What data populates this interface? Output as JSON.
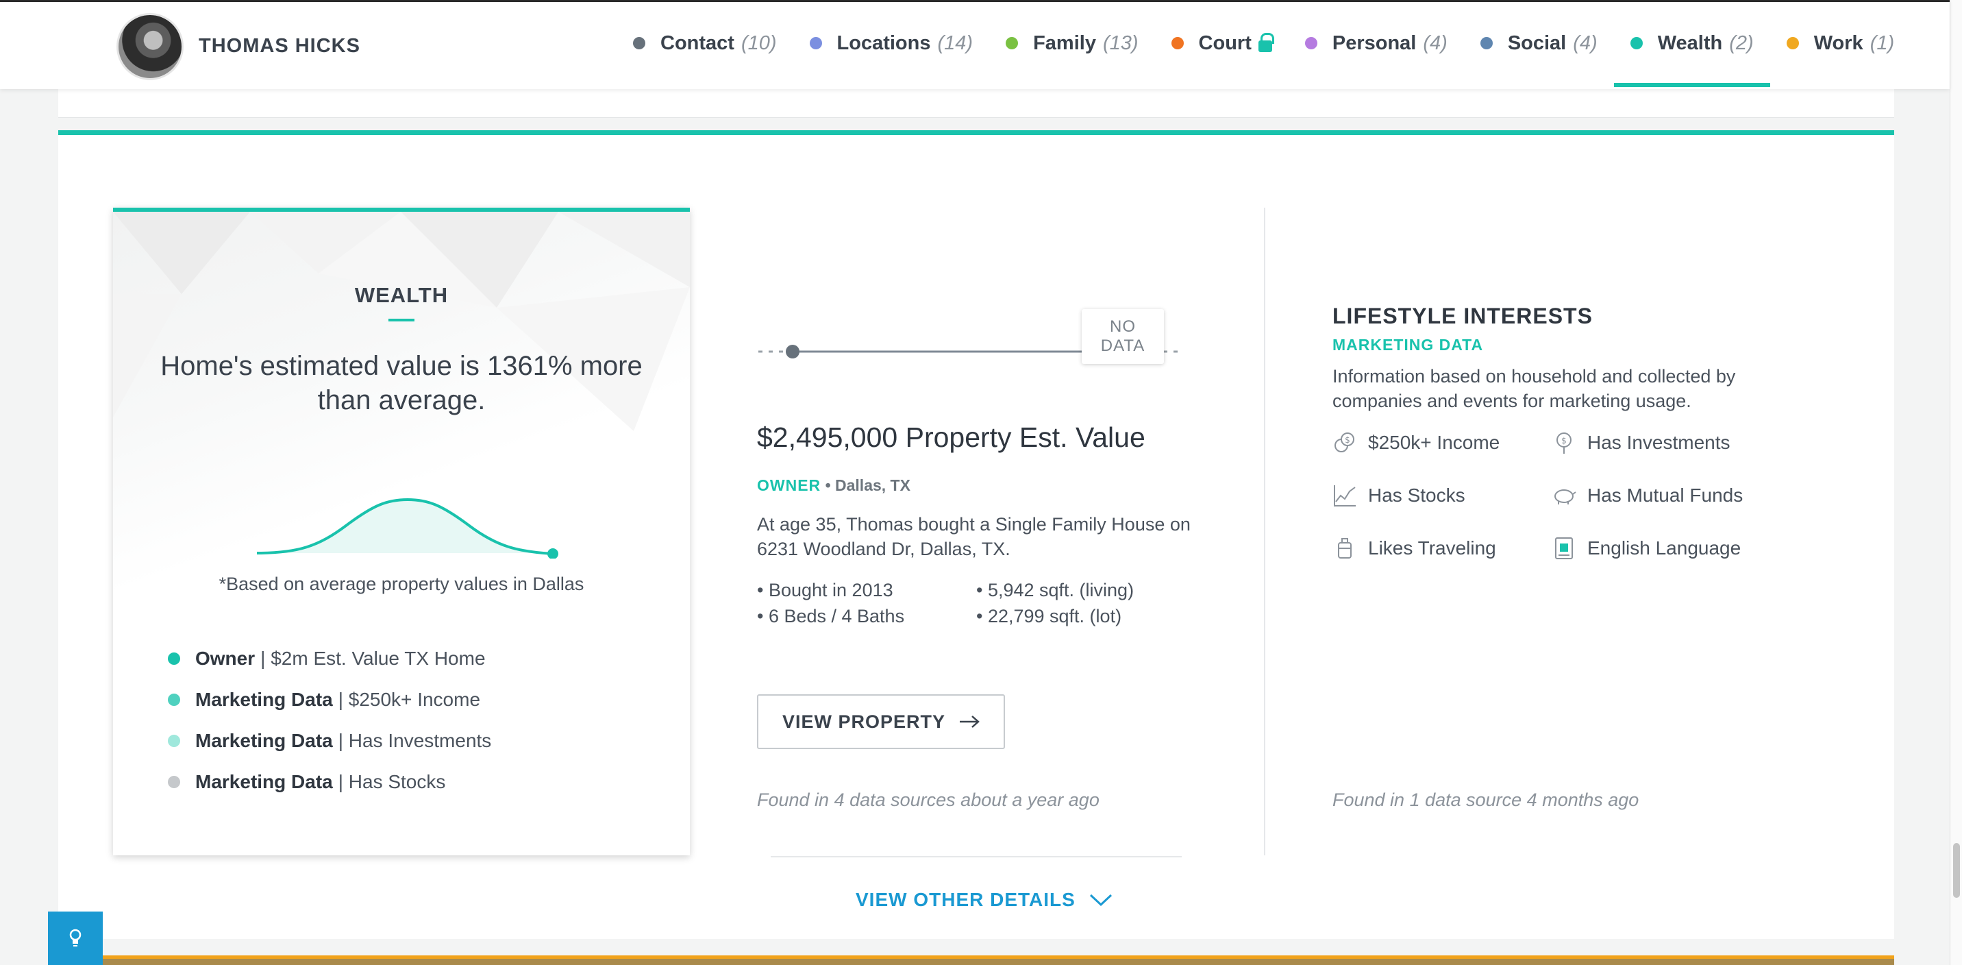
{
  "profile": {
    "name": "THOMAS HICKS"
  },
  "nav": [
    {
      "label": "Contact",
      "count": "(10)",
      "color": "#67717b"
    },
    {
      "label": "Locations",
      "count": "(14)",
      "color": "#7b8fe0"
    },
    {
      "label": "Family",
      "count": "(13)",
      "color": "#7ac142"
    },
    {
      "label": "Court",
      "count": "",
      "color": "#f07422"
    },
    {
      "label": "Personal",
      "count": "(4)",
      "color": "#b57be0"
    },
    {
      "label": "Social",
      "count": "(4)",
      "color": "#5f86b0"
    },
    {
      "label": "Wealth",
      "count": "(2)",
      "color": "#19c2ac"
    },
    {
      "label": "Work",
      "count": "(1)",
      "color": "#f0a820"
    }
  ],
  "wealth": {
    "heading": "WEALTH",
    "statement": "Home's estimated value is 1361% more than average.",
    "note": "*Based on average property values in Dallas",
    "items": [
      {
        "bold": "Owner",
        "text": "| $2m Est. Value TX Home",
        "color": "#19c2ac"
      },
      {
        "bold": "Marketing Data",
        "text": "| $250k+ Income",
        "color": "#4fd1bf"
      },
      {
        "bold": "Marketing Data",
        "text": "| Has Investments",
        "color": "#9fe8dc"
      },
      {
        "bold": "Marketing Data",
        "text": "| Has Stocks",
        "color": "#c5c8cb"
      }
    ]
  },
  "property": {
    "no_data_line1": "NO",
    "no_data_line2": "DATA",
    "title": "$2,495,000 Property Est. Value",
    "role": "OWNER",
    "separator": "•",
    "location": "Dallas, TX",
    "description": "At age 35, Thomas bought a Single Family House on 6231 Woodland Dr, Dallas, TX.",
    "facts": [
      "• Bought in 2013",
      "• 5,942 sqft. (living)",
      "• 6 Beds / 4 Baths",
      "• 22,799 sqft. (lot)"
    ],
    "button_label": "VIEW PROPERTY",
    "found": "Found in 4 data sources about a year ago"
  },
  "lifestyle": {
    "title": "LIFESTYLE INTERESTS",
    "subtitle": "MARKETING DATA",
    "description": "Information based on household and collected by companies and events for marketing usage.",
    "interests": [
      {
        "label": "$250k+ Income",
        "icon": "coins-icon"
      },
      {
        "label": "Has Investments",
        "icon": "money-bag-icon"
      },
      {
        "label": "Has Stocks",
        "icon": "stock-chart-icon"
      },
      {
        "label": "Has Mutual Funds",
        "icon": "piggy-bank-icon"
      },
      {
        "label": "Likes Traveling",
        "icon": "luggage-icon"
      },
      {
        "label": "English Language",
        "icon": "language-book-icon"
      }
    ],
    "found": "Found in 1 data source 4 months ago"
  },
  "footer": {
    "other_details": "VIEW OTHER DETAILS"
  },
  "colors": {
    "accent": "#19c2ac",
    "link": "#1a99d2"
  }
}
